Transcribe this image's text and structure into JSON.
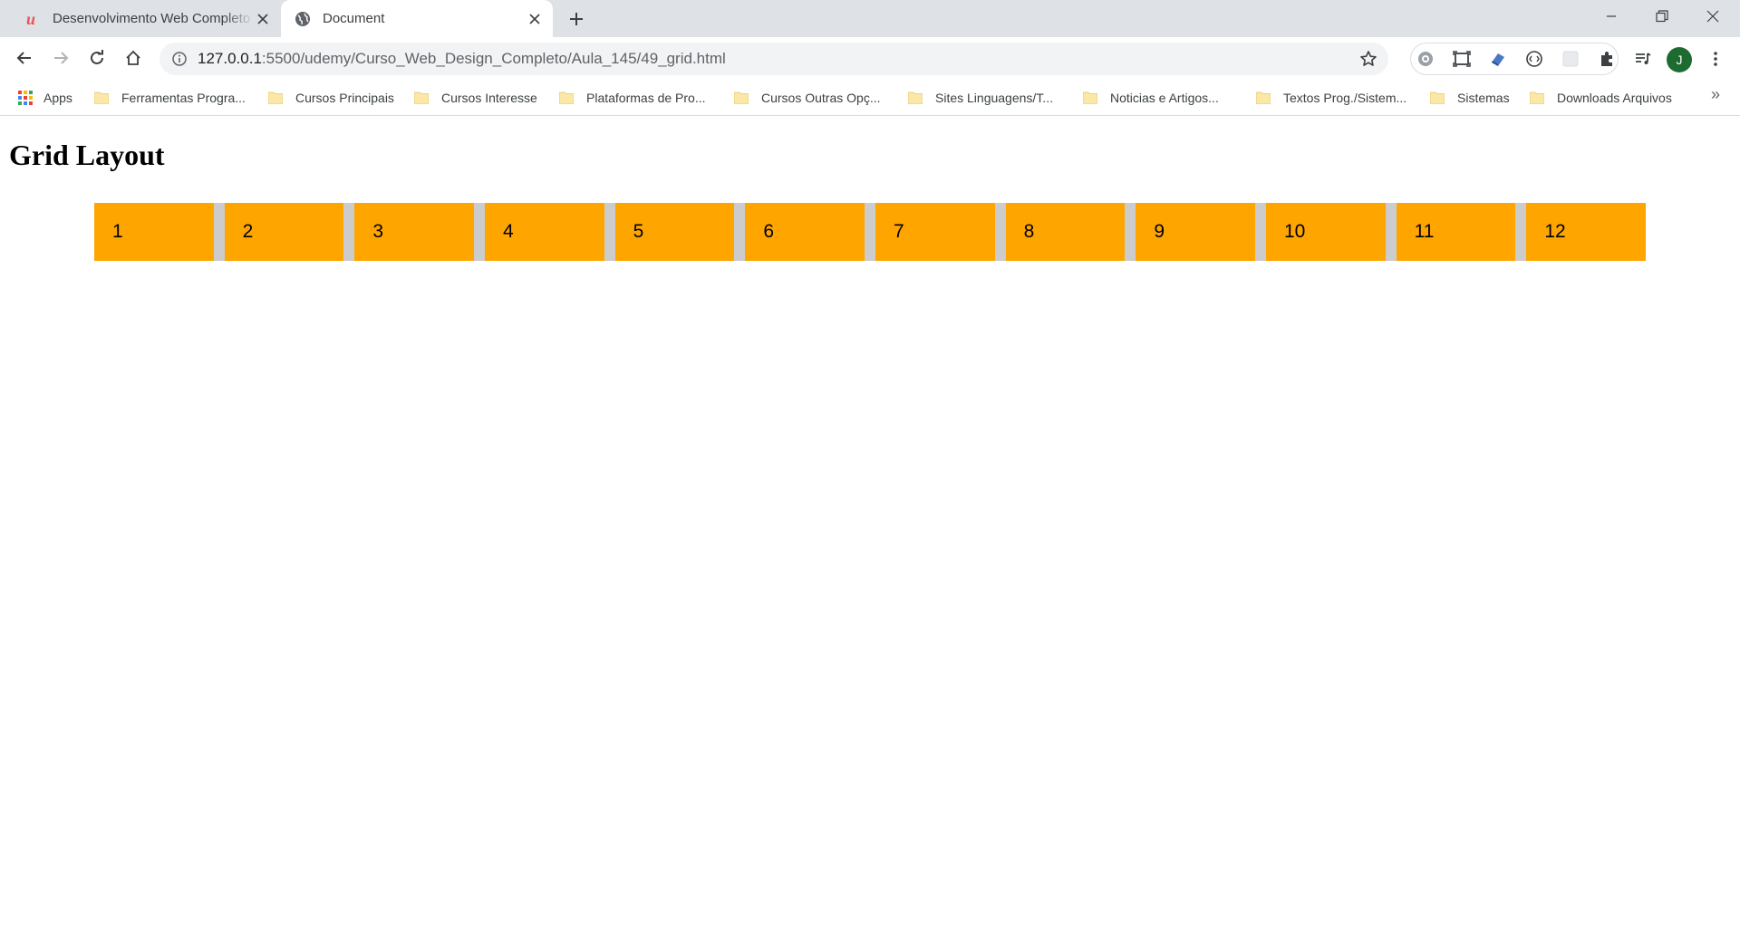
{
  "browser": {
    "tabs": [
      {
        "title": "Desenvolvimento Web Completo",
        "favicon": "udemy-icon",
        "active": false
      },
      {
        "title": "Document",
        "favicon": "globe-icon",
        "active": true
      }
    ],
    "address": {
      "host": "127.0.0.1",
      "path": ":5500/udemy/Curso_Web_Design_Completo/Aula_145/49_grid.html"
    },
    "avatar_initial": "J",
    "bookmarks": {
      "apps_label": "Apps",
      "items": [
        "Ferramentas Progra...",
        "Cursos Principais",
        "Cursos Interesse",
        "Plataformas de Pro...",
        "Cursos Outras Opç...",
        "Sites Linguagens/T...",
        "Noticias e Artigos...",
        "Textos Prog./Sistem...",
        "Sistemas",
        "Downloads Arquivos"
      ],
      "more": "»"
    }
  },
  "page": {
    "heading": "Grid Layout",
    "items": [
      "1",
      "2",
      "3",
      "4",
      "5",
      "6",
      "7",
      "8",
      "9",
      "10",
      "11",
      "12"
    ],
    "colors": {
      "item_bg": "#ffa500",
      "grid_bg": "#cccccc"
    }
  }
}
